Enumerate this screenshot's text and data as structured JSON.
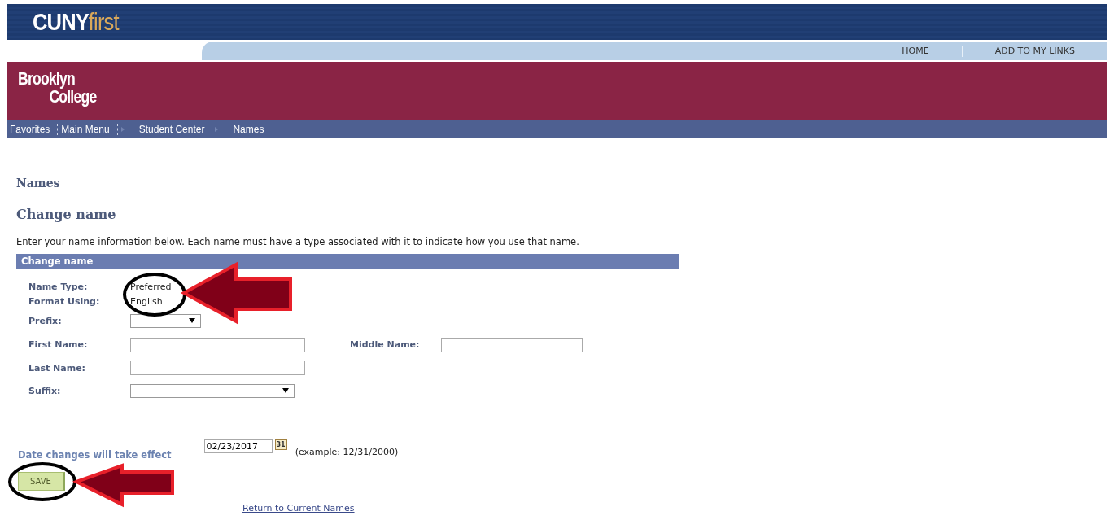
{
  "header": {
    "logo_main": "CUNY",
    "logo_accent": "first",
    "links": [
      "HOME",
      "ADD TO MY LINKS"
    ],
    "college_line1": "Brooklyn",
    "college_line2": "College"
  },
  "breadcrumbs": [
    {
      "label": "Favorites",
      "kind": "menu"
    },
    {
      "label": "Main Menu",
      "kind": "menu"
    },
    {
      "label": "Student Center",
      "kind": "crumb"
    },
    {
      "label": "Names",
      "kind": "crumb"
    }
  ],
  "page_title": "Names",
  "section_title": "Change name",
  "instructions": "Enter your name information below. Each name must have a type associated with it to indicate how you use that name.",
  "panel_title": "Change name",
  "name_type": {
    "label": "Name Type:",
    "value": "Preferred"
  },
  "format": {
    "label": "Format Using:",
    "value": "English"
  },
  "prefix": {
    "label": "Prefix:"
  },
  "first_name": {
    "label": "First Name:"
  },
  "middle_name": {
    "label": "Middle Name:"
  },
  "last_name": {
    "label": "Last Name:"
  },
  "suffix": {
    "label": "Suffix:"
  },
  "effective_date": {
    "label": "Date changes will take effect",
    "value": "02/23/2017",
    "calendar_day": "31",
    "example": "(example: 12/31/2000)"
  },
  "save_button": "SAVE",
  "return_link": "Return to Current Names"
}
